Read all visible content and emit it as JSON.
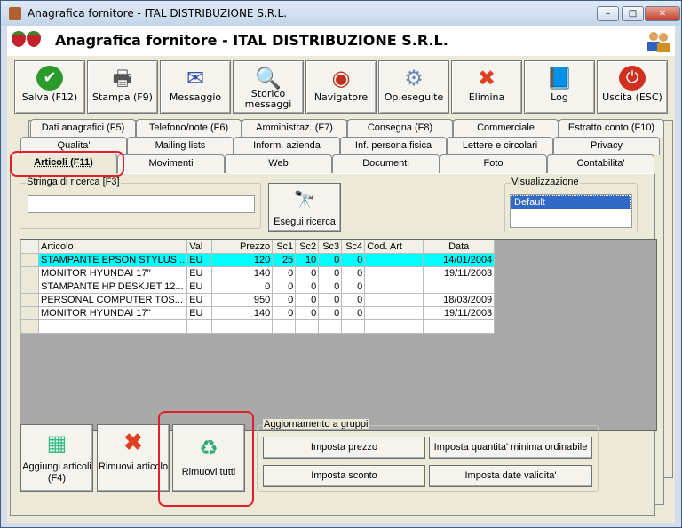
{
  "window": {
    "title": "Anagrafica fornitore - ITAL DISTRIBUZIONE S.R.L.",
    "header": "Anagrafica fornitore - ITAL DISTRIBUZIONE S.R.L."
  },
  "toolbar": [
    {
      "label": "Salva (F12)",
      "icon": "check-icon"
    },
    {
      "label": "Stampa (F9)",
      "icon": "printer-icon"
    },
    {
      "label": "Messaggio",
      "icon": "envelope-icon"
    },
    {
      "label": "Storico messaggi",
      "icon": "message-history-icon"
    },
    {
      "label": "Navigatore",
      "icon": "navigator-icon"
    },
    {
      "label": "Op.eseguite",
      "icon": "gears-icon"
    },
    {
      "label": "Elimina",
      "icon": "delete-icon"
    },
    {
      "label": "Log",
      "icon": "log-icon"
    },
    {
      "label": "Uscita (ESC)",
      "icon": "exit-icon"
    }
  ],
  "tabs": {
    "row1": [
      "Dati anagrafici (F5)",
      "Telefono/note (F6)",
      "Amministraz. (F7)",
      "Consegna (F8)",
      "Commerciale",
      "Estratto conto (F10)"
    ],
    "row2": [
      "Qualita'",
      "Mailing lists",
      "Inform. azienda",
      "Inf. persona fisica",
      "Lettere e circolari",
      "Privacy"
    ],
    "row3": [
      "Articoli (F11)",
      "Movimenti",
      "Web",
      "Documenti",
      "Foto",
      "Contabilita'"
    ]
  },
  "search": {
    "label": "Stringa di ricerca [F3]",
    "value": "",
    "button": "Esegui ricerca"
  },
  "view": {
    "label": "Visualizzazione",
    "options": [
      "Default"
    ]
  },
  "table": {
    "columns": [
      "Articolo",
      "Val",
      "Prezzo",
      "Sc1",
      "Sc2",
      "Sc3",
      "Sc4",
      "Cod. Art",
      "Data"
    ],
    "rows": [
      [
        "STAMPANTE EPSON STYLUS...",
        "EU",
        "120",
        "25",
        "10",
        "0",
        "0",
        "",
        "14/01/2004"
      ],
      [
        "MONITOR HYUNDAI 17''",
        "EU",
        "140",
        "0",
        "0",
        "0",
        "0",
        "",
        "19/11/2003"
      ],
      [
        "STAMPANTE HP DESKJET 12...",
        "EU",
        "0",
        "0",
        "0",
        "0",
        "0",
        "",
        ""
      ],
      [
        "PERSONAL COMPUTER TOS...",
        "EU",
        "950",
        "0",
        "0",
        "0",
        "0",
        "",
        "18/03/2009"
      ],
      [
        "MONITOR HYUNDAI 17''",
        "EU",
        "140",
        "0",
        "0",
        "0",
        "0",
        "",
        "19/11/2003"
      ]
    ]
  },
  "actions": {
    "add": "Aggiungi articoli (F4)",
    "remove": "Rimuovi articolo",
    "remove_all": "Rimuovi tutti"
  },
  "group": {
    "label": "Aggiornamento a gruppi",
    "buttons": [
      "Imposta prezzo",
      "Imposta quantita' minima ordinabile",
      "Imposta sconto",
      "Imposta date validita'"
    ]
  }
}
